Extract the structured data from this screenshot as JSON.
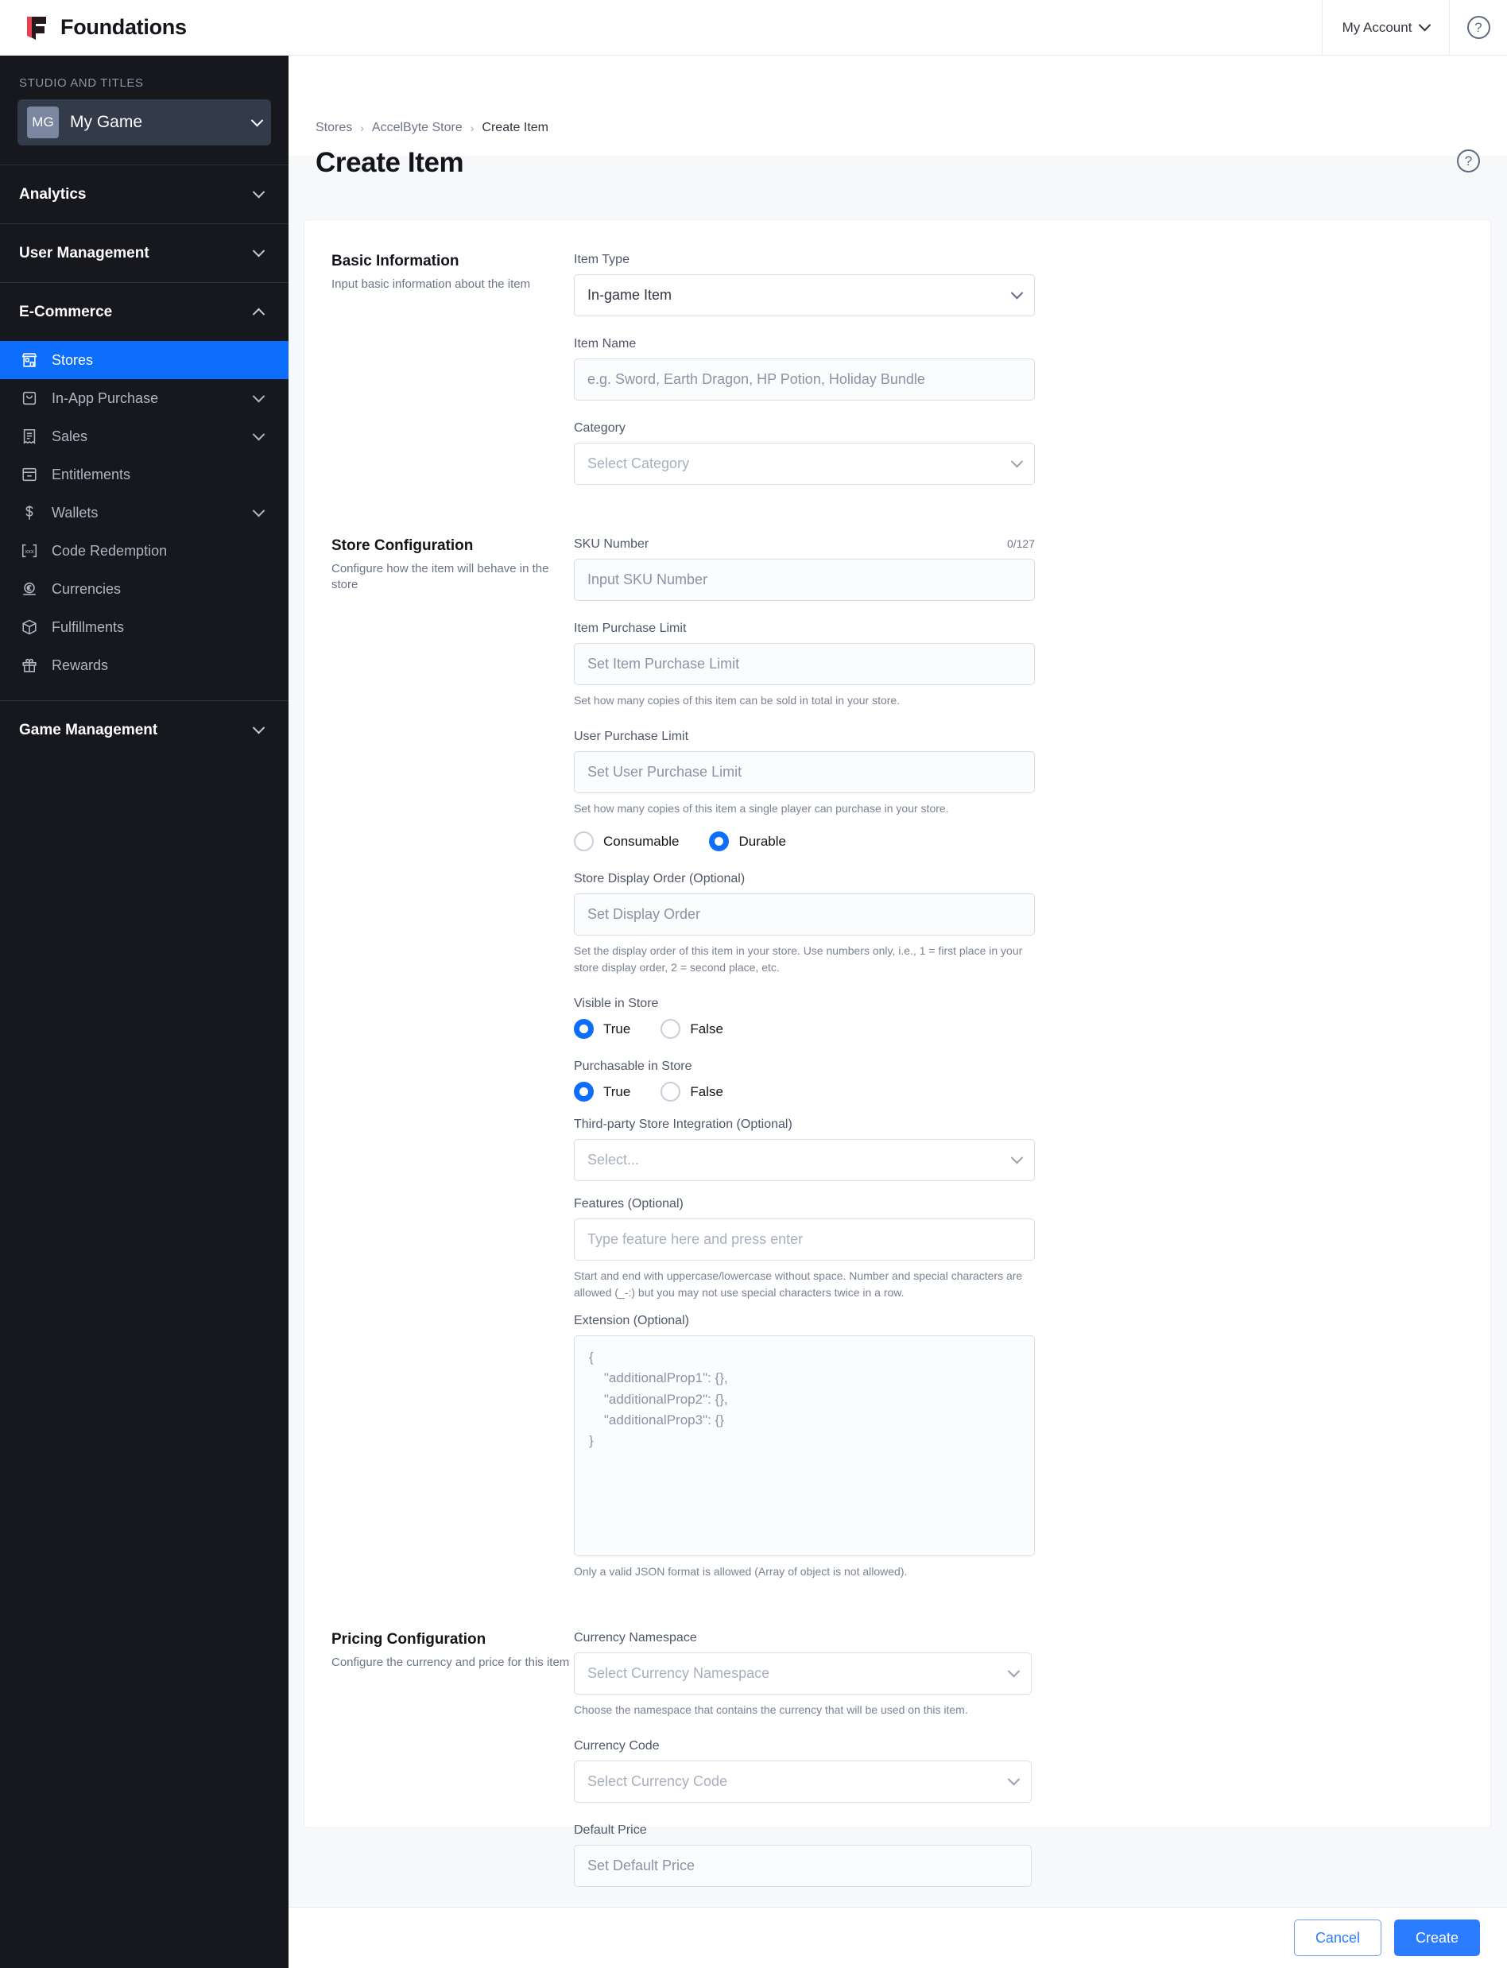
{
  "app": {
    "brand_name": "Foundations",
    "account_label": "My Account",
    "help_icon": "question-circle-icon",
    "accent_blue": "#0d6efd",
    "brand_red": "#e8414f",
    "sidebar_bg": "#16181d"
  },
  "sidebar": {
    "studio_label": "STUDIO AND TITLES",
    "game": {
      "initials": "MG",
      "name": "My Game"
    },
    "groups": [
      {
        "label": "Analytics",
        "icon": "chevron-down-icon",
        "expanded": false
      },
      {
        "label": "User Management",
        "icon": "chevron-down-icon",
        "expanded": false
      },
      {
        "label": "E-Commerce",
        "icon": "chevron-up-icon",
        "expanded": true
      },
      {
        "label": "Game Management",
        "icon": "chevron-down-icon",
        "expanded": false
      }
    ],
    "ecommerce_items": [
      {
        "label": "Stores",
        "icon": "store-icon",
        "active": true,
        "chevron": false
      },
      {
        "label": "In-App Purchase",
        "icon": "bag-icon",
        "active": false,
        "chevron": true
      },
      {
        "label": "Sales",
        "icon": "receipt-icon",
        "active": false,
        "chevron": true
      },
      {
        "label": "Entitlements",
        "icon": "archive-icon",
        "active": false,
        "chevron": false
      },
      {
        "label": "Wallets",
        "icon": "dollar-icon",
        "active": false,
        "chevron": true
      },
      {
        "label": "Code Redemption",
        "icon": "code-brackets-icon",
        "active": false,
        "chevron": false
      },
      {
        "label": "Currencies",
        "icon": "coin-euro-icon",
        "active": false,
        "chevron": false
      },
      {
        "label": "Fulfillments",
        "icon": "box-icon",
        "active": false,
        "chevron": false
      },
      {
        "label": "Rewards",
        "icon": "gift-icon",
        "active": false,
        "chevron": false
      }
    ]
  },
  "page": {
    "breadcrumb": [
      "Stores",
      "AccelByte Store",
      "Create Item"
    ],
    "title": "Create Item",
    "help_icon": "question-circle-icon"
  },
  "basic_information": {
    "title": "Basic Information",
    "description": "Input basic information about the item",
    "item_type": {
      "label": "Item Type",
      "value": "In-game Item",
      "icon": "chevron-down-icon"
    },
    "item_name": {
      "label": "Item Name",
      "value": "",
      "placeholder": "e.g. Sword, Earth Dragon, HP Potion, Holiday Bundle"
    },
    "category": {
      "label": "Category",
      "value": "",
      "placeholder": "Select Category",
      "icon": "chevron-down-icon"
    }
  },
  "store_configuration": {
    "title": "Store Configuration",
    "description": "Configure how the item will behave in the store",
    "sku": {
      "label": "SKU Number",
      "counter": "0/127",
      "value": "",
      "placeholder": "Input SKU Number"
    },
    "item_purchase_limit": {
      "label": "Item Purchase Limit",
      "value": "",
      "placeholder": "Set Item Purchase Limit",
      "hint": "Set how many copies of this item can be sold in total in your store."
    },
    "user_purchase_limit": {
      "label": "User Purchase Limit",
      "value": "",
      "placeholder": "Set User Purchase Limit",
      "hint": "Set how many copies of this item a single player can purchase in your store."
    },
    "durability": {
      "options": [
        {
          "label": "Consumable",
          "selected": false
        },
        {
          "label": "Durable",
          "selected": true
        }
      ]
    },
    "display_order": {
      "label": "Store Display Order (Optional)",
      "value": "",
      "placeholder": "Set Display Order",
      "hint": "Set the display order of this item in your store. Use numbers only, i.e., 1 = first place in your store display order, 2 = second place, etc."
    },
    "visible_in_store": {
      "label": "Visible in Store",
      "options": [
        {
          "label": "True",
          "selected": true
        },
        {
          "label": "False",
          "selected": false
        }
      ]
    },
    "purchasable_in_store": {
      "label": "Purchasable in Store",
      "options": [
        {
          "label": "True",
          "selected": true
        },
        {
          "label": "False",
          "selected": false
        }
      ]
    },
    "third_party": {
      "label": "Third-party Store Integration (Optional)",
      "value": "",
      "placeholder": "Select...",
      "icon": "chevron-down-icon"
    },
    "features": {
      "label": "Features (Optional)",
      "value": "",
      "placeholder": "Type feature here and press enter",
      "hint": "Start and end with uppercase/lowercase without space. Number and special characters are allowed (_-:) but you may not use special characters twice in a row."
    },
    "extension": {
      "label": "Extension (Optional)",
      "placeholder": "{\n    \"additionalProp1\": {},\n    \"additionalProp2\": {},\n    \"additionalProp3\": {}\n}",
      "hint": "Only a valid JSON format is allowed (Array of object is not allowed)."
    }
  },
  "pricing_configuration": {
    "title": "Pricing Configuration",
    "description": "Configure the currency and price for this item",
    "currency_namespace": {
      "label": "Currency Namespace",
      "value": "",
      "placeholder": "Select Currency Namespace",
      "icon": "chevron-down-icon",
      "hint": "Choose the namespace that contains the currency that will be used on this item."
    },
    "currency_code": {
      "label": "Currency Code",
      "value": "",
      "placeholder": "Select Currency Code",
      "icon": "chevron-down-icon"
    },
    "default_price": {
      "label": "Default Price",
      "value": "",
      "placeholder": "Set Default Price"
    }
  },
  "footer": {
    "cancel_label": "Cancel",
    "create_label": "Create"
  }
}
